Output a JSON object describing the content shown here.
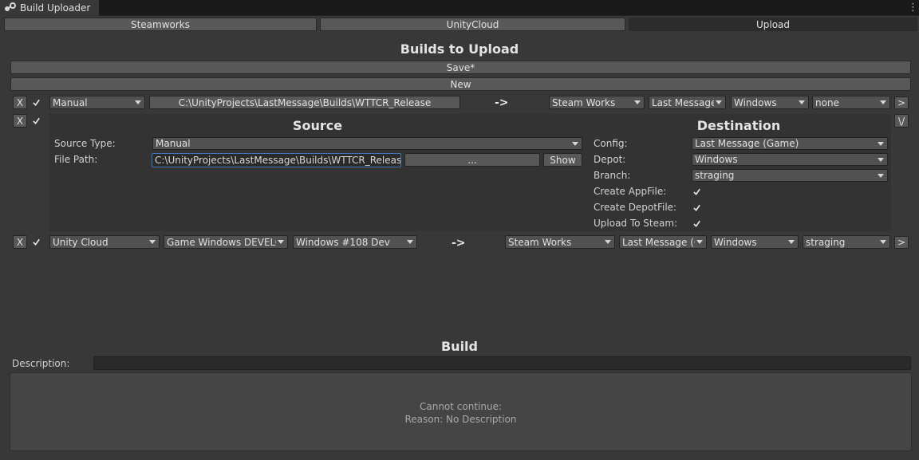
{
  "window": {
    "title": "Build Uploader",
    "menu_icon": "kebab-menu-icon"
  },
  "tabs": [
    {
      "label": "Steamworks",
      "active": false
    },
    {
      "label": "UnityCloud",
      "active": false
    },
    {
      "label": "Upload",
      "active": true
    }
  ],
  "builds": {
    "heading": "Builds to Upload",
    "save_label": "Save*",
    "new_label": "New",
    "remove_label": "X",
    "arrow": "->",
    "expand_label": ">",
    "collapse_label": "\\/",
    "row1": {
      "source_type": "Manual",
      "path": "C:\\UnityProjects\\LastMessage\\Builds\\WTTCR_Release",
      "dest_service": "Steam Works",
      "dest_config": "Last Message",
      "dest_depot": "Windows",
      "dest_branch": "none"
    },
    "source": {
      "heading": "Source",
      "source_type_label": "Source Type:",
      "source_type_value": "Manual",
      "file_path_label": "File Path:",
      "file_path_value": "C:\\UnityProjects\\LastMessage\\Builds\\WTTCR_Release",
      "browse_label": "...",
      "show_label": "Show"
    },
    "destination": {
      "heading": "Destination",
      "config_label": "Config:",
      "config_value": "Last Message (Game)",
      "depot_label": "Depot:",
      "depot_value": "Windows",
      "branch_label": "Branch:",
      "branch_value": "straging",
      "create_appfile_label": "Create AppFile:",
      "create_depotfile_label": "Create DepotFile:",
      "upload_to_steam_label": "Upload To Steam:"
    },
    "row2": {
      "source_service": "Unity Cloud",
      "target": "Game Windows DEVELO",
      "build": "Windows #108 Dev",
      "dest_service": "Steam Works",
      "dest_config": "Last Message (G",
      "dest_depot": "Windows",
      "dest_branch": "straging"
    }
  },
  "build": {
    "heading": "Build",
    "description_label": "Description:",
    "description_value": "",
    "message_line1": "Cannot continue:",
    "message_line2": "Reason: No Description"
  },
  "colors": {
    "background": "#383838",
    "button": "#585858",
    "field": "#2a2a2a",
    "focus": "#3a79bb"
  }
}
